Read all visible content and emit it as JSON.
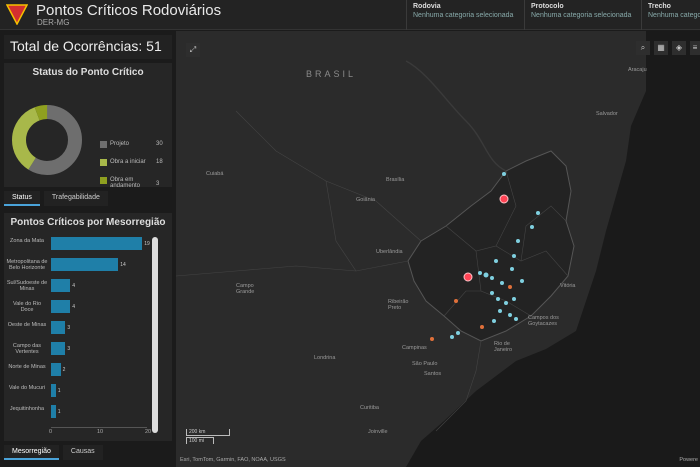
{
  "header": {
    "title": "Pontos Críticos Rodoviários",
    "subtitle": "DER-MG",
    "filters": [
      {
        "label": "Rodovia",
        "value": "Nenhuma categoria selecionada"
      },
      {
        "label": "Protocolo",
        "value": "Nenhuma categoria selecionada"
      },
      {
        "label": "Trecho",
        "value": "Nenhuma categoria"
      }
    ]
  },
  "total": "Total de Ocorrências: 51",
  "status_card": {
    "title": "Status do Ponto Crítico",
    "legend": [
      {
        "label": "Projeto",
        "value": "30",
        "color": "#6e6e6e"
      },
      {
        "label": "Obra a iniciar",
        "value": "18",
        "color": "#a8b84a"
      },
      {
        "label": "Obra em andamento",
        "value": "3",
        "color": "#8fa020"
      }
    ]
  },
  "tabs_status": [
    "Status",
    "Trafegabilidade"
  ],
  "meso_card": {
    "title": "Pontos Críticos por Mesorregião"
  },
  "chart_data": {
    "type": "bar",
    "orientation": "horizontal",
    "categories": [
      "Zona da Mata",
      "Metropolitana de Belo Horizonte",
      "Sul/Sudoeste de Minas",
      "Vale do Rio Doce",
      "Oeste de Minas",
      "Campo das Vertentes",
      "Norte de Minas",
      "Vale do Mucuri",
      "Jequitinhonha"
    ],
    "values": [
      19,
      14,
      4,
      4,
      3,
      3,
      2,
      1,
      1
    ],
    "xlim": [
      0,
      20
    ],
    "xticks": [
      "0",
      "10",
      "20"
    ]
  },
  "tabs_bottom": [
    "Mesorregião",
    "Causas"
  ],
  "map": {
    "labels": [
      {
        "text": "BRASIL"
      },
      {
        "text": "Aracaju"
      },
      {
        "text": "Salvador"
      },
      {
        "text": "Brasília"
      },
      {
        "text": "Goiânia"
      },
      {
        "text": "Cuiabá"
      },
      {
        "text": "Uberlândia"
      },
      {
        "text": "Campo Grande"
      },
      {
        "text": "Ribeirão Preto"
      },
      {
        "text": "Vitória"
      },
      {
        "text": "Campos dos Goytacazes"
      },
      {
        "text": "Campinas"
      },
      {
        "text": "Rio de Janeiro"
      },
      {
        "text": "São Paulo"
      },
      {
        "text": "Santos"
      },
      {
        "text": "Londrina"
      },
      {
        "text": "Curitiba"
      },
      {
        "text": "Joinville"
      }
    ],
    "scale_km": "200 km",
    "scale_mi": "100 mi",
    "attribution": "Esri, TomTom, Garmin, FAO, NOAA, USGS",
    "powered": "Powere",
    "marker_colors": {
      "cluster": "#7fd0e0",
      "critical": "#ff4455",
      "orange": "#e0703a"
    }
  }
}
